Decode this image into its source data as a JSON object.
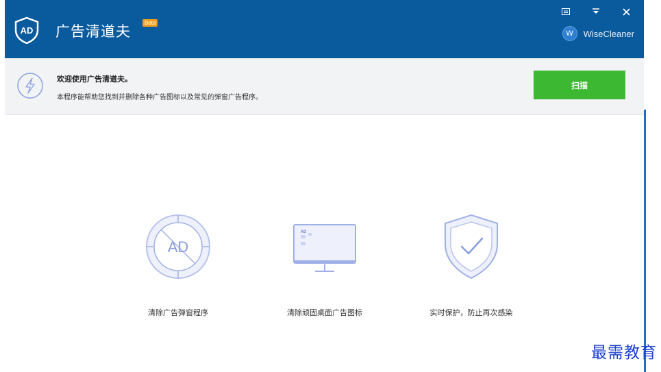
{
  "titlebar": {
    "title": "广告清道夫",
    "beta_badge": "Beta",
    "logo_icon": "ad-shield-icon",
    "brand_badge": "W",
    "brand_name": "WiseCleaner",
    "controls": [
      "menu-icon",
      "minimize-icon",
      "close-icon"
    ],
    "color": "#0a5a9e"
  },
  "banner": {
    "icon": "lightning-icon",
    "title": "欢迎使用广告清道夫。",
    "description": "本程序能帮助您找到并删除各种广告图标以及常见的弹窗广告程序。",
    "scan_label": "扫描",
    "scan_color": "#3cb832"
  },
  "features": [
    {
      "icon": "ad-target-icon",
      "label": "清除广告弹窗程序",
      "icon_text": "AD"
    },
    {
      "icon": "monitor-icon",
      "label": "清除顽固桌面广告图标",
      "icon_text": "AD"
    },
    {
      "icon": "shield-check-icon",
      "label": "实时保护，防止再次感染"
    }
  ],
  "watermark": "最需教育"
}
